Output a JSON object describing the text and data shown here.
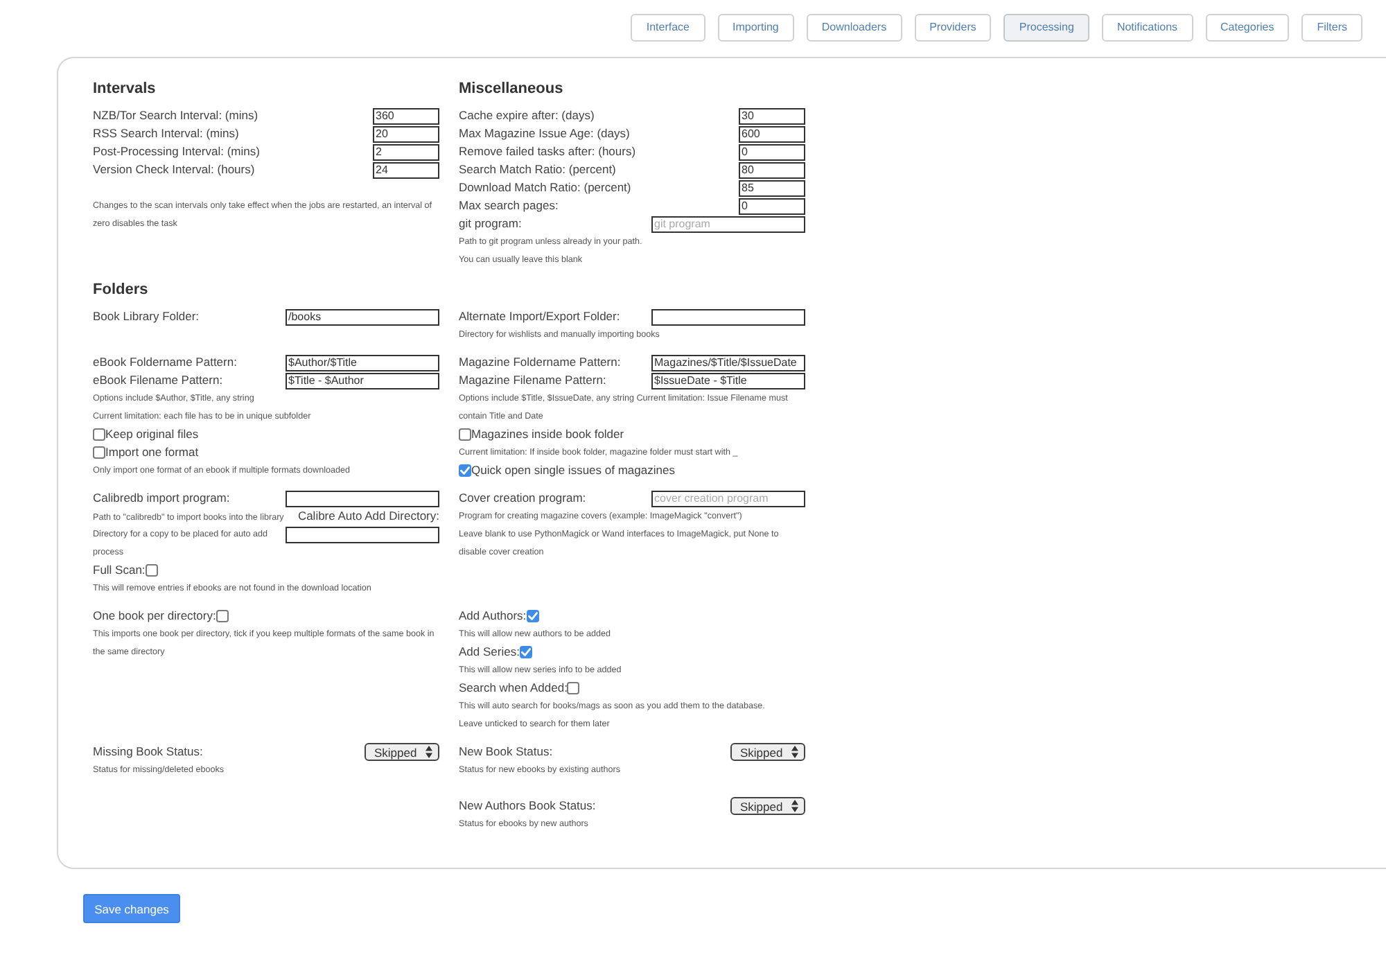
{
  "tabs": [
    {
      "label": "Interface",
      "selected": false
    },
    {
      "label": "Importing",
      "selected": false
    },
    {
      "label": "Downloaders",
      "selected": false
    },
    {
      "label": "Providers",
      "selected": false
    },
    {
      "label": "Processing",
      "selected": true
    },
    {
      "label": "Notifications",
      "selected": false
    },
    {
      "label": "Categories",
      "selected": false
    },
    {
      "label": "Filters",
      "selected": false
    }
  ],
  "settings": {
    "rows": [
      {
        "left": [
          {
            "kind": "heading",
            "text": "Intervals"
          },
          {
            "kind": "number",
            "label": "NZB/Tor Search Interval: (mins)",
            "value": "360"
          },
          {
            "kind": "number",
            "label": "RSS Search Interval: (mins)",
            "value": "20"
          },
          {
            "kind": "number",
            "label": "Post-Processing Interval: (mins)",
            "value": "2"
          },
          {
            "kind": "number",
            "label": "Version Check Interval: (hours)",
            "value": "24"
          },
          {
            "kind": "help",
            "text": "Changes to the scan intervals only take effect when the jobs are restarted, an interval of zero disables the task"
          }
        ],
        "right": [
          {
            "kind": "heading",
            "text": "Miscellaneous"
          },
          {
            "kind": "number",
            "label": "Cache expire after: (days)",
            "value": "30"
          },
          {
            "kind": "number",
            "label": "Max Magazine Issue Age: (days)",
            "value": "600"
          },
          {
            "kind": "number",
            "label": "Remove failed tasks after: (hours)",
            "value": "0"
          },
          {
            "kind": "number",
            "label": "Search Match Ratio: (percent)",
            "value": "80"
          },
          {
            "kind": "number",
            "label": "Download Match Ratio: (percent)",
            "value": "85"
          },
          {
            "kind": "number",
            "label": "Max search pages:",
            "value": "0"
          },
          {
            "kind": "text",
            "label": "git program:",
            "placeholder": "git program"
          },
          {
            "kind": "help",
            "text": "Path to git program unless already in your path."
          },
          {
            "kind": "help",
            "text": "You can usually leave this blank"
          }
        ]
      },
      {
        "left": [
          {
            "kind": "heading",
            "text": "Folders"
          }
        ]
      },
      {
        "left": [
          {
            "kind": "text",
            "label": "Book Library Folder:",
            "value": "/books"
          }
        ],
        "right": [
          {
            "kind": "text",
            "label": "Alternate Import/Export Folder:"
          },
          {
            "kind": "help",
            "text": "Directory for wishlists and manually importing books"
          }
        ]
      },
      {
        "left": [
          {
            "kind": "text",
            "label": "eBook Foldername Pattern:",
            "value": "$Author/$Title"
          },
          {
            "kind": "text",
            "label": "eBook Filename Pattern:",
            "value": "$Title - $Author"
          },
          {
            "kind": "help",
            "text": "Options include $Author, $Title, any string"
          },
          {
            "kind": "help",
            "text": "Current limitation: each file has to be in unique subfolder"
          },
          {
            "kind": "checkbox",
            "label": "Keep original files",
            "checked": false
          },
          {
            "kind": "checkbox",
            "label": "Import one format",
            "checked": false
          },
          {
            "kind": "help",
            "text": "Only import one format of an ebook if multiple formats downloaded"
          }
        ],
        "right": [
          {
            "kind": "text",
            "label": "Magazine Foldername Pattern:",
            "value": "Magazines/$Title/$IssueDate"
          },
          {
            "kind": "text",
            "label": "Magazine Filename Pattern:",
            "value": "$IssueDate - $Title"
          },
          {
            "kind": "help",
            "text": "Options include $Title, $IssueDate, any string Current limitation: Issue Filename must contain Title and Date"
          },
          {
            "kind": "checkbox",
            "label": "Magazines inside book folder",
            "checked": false
          },
          {
            "kind": "help",
            "text": "Current limitation: If inside book folder, magazine folder must start with _"
          },
          {
            "kind": "checkbox",
            "label": "Quick open single issues of magazines",
            "checked": true
          }
        ]
      },
      {
        "left": [
          {
            "kind": "text",
            "label": "Calibredb import program:"
          },
          {
            "kind": "split",
            "note": "Path to \"calibredb\" to import books into the library",
            "label": "Calibre Auto Add Directory:",
            "help": "Directory for a copy to be placed for auto add process"
          },
          {
            "kind": "flag",
            "label": "Full Scan:",
            "checked": false
          },
          {
            "kind": "help",
            "text": "This will remove entries if ebooks are not found in the download location"
          }
        ],
        "right": [
          {
            "kind": "text",
            "label": "Cover creation program:",
            "placeholder": "cover creation program"
          },
          {
            "kind": "help",
            "text": "Program for creating magazine covers (example: ImageMagick \"convert\")"
          },
          {
            "kind": "help",
            "text": "Leave blank to use PythonMagick or Wand interfaces to ImageMagick, put None to disable cover creation"
          }
        ]
      },
      {
        "left": [
          {
            "kind": "flag",
            "label": "One book per directory:",
            "checked": false
          },
          {
            "kind": "help",
            "text": "This imports one book per directory, tick if you keep multiple formats of the same book in the same directory"
          }
        ],
        "right": [
          {
            "kind": "flag",
            "label": "Add Authors:",
            "checked": true
          },
          {
            "kind": "help",
            "text": "This will allow new authors to be added"
          },
          {
            "kind": "flag",
            "label": "Add Series:",
            "checked": true
          },
          {
            "kind": "help",
            "text": "This will allow new series info to be added"
          },
          {
            "kind": "flag",
            "label": "Search when Added:",
            "checked": false
          },
          {
            "kind": "help",
            "text": "This will auto search for books/mags as soon as you add them to the database."
          },
          {
            "kind": "help",
            "text": "Leave unticked to search for them later"
          }
        ]
      },
      {
        "left": [
          {
            "kind": "select",
            "label": "Missing Book Status:",
            "value": "Skipped"
          },
          {
            "kind": "help",
            "text": "Status for missing/deleted ebooks"
          }
        ],
        "right": [
          {
            "kind": "select",
            "label": "New Book Status:",
            "value": "Skipped"
          },
          {
            "kind": "help",
            "text": "Status for new ebooks by existing authors"
          },
          {
            "kind": "select",
            "label": "New Authors Book Status:",
            "value": "Skipped"
          },
          {
            "kind": "help",
            "text": "Status for ebooks by new authors"
          }
        ]
      }
    ]
  },
  "save_button": {
    "label": "Save changes"
  }
}
